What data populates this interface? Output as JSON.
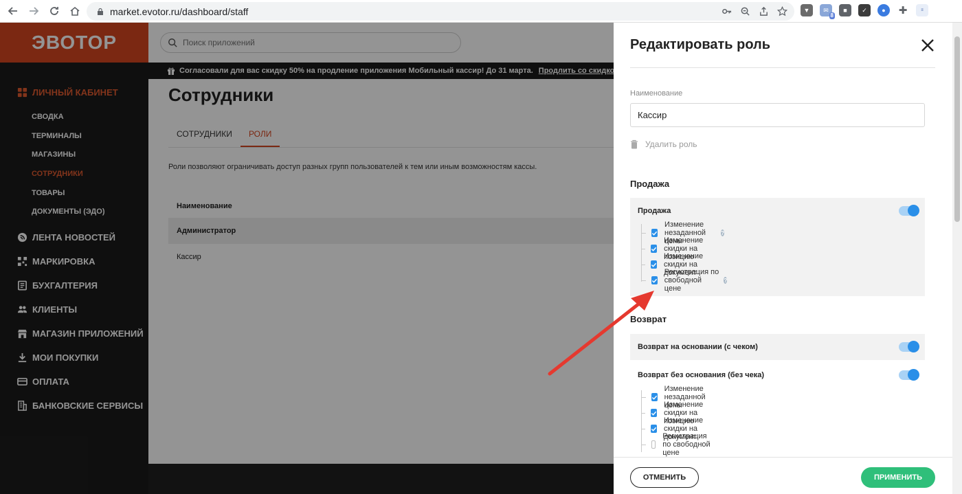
{
  "browser": {
    "url": "market.evotor.ru/dashboard/staff"
  },
  "sidebar": {
    "logo": "ЭВОТОР",
    "sections": [
      {
        "label": "ЛИЧНЫЙ КАБИНЕТ",
        "icon": "grid-icon",
        "active": true
      },
      {
        "label": "ЛЕНТА НОВОСТЕЙ",
        "icon": "news-icon"
      },
      {
        "label": "МАРКИРОВКА",
        "icon": "qr-icon"
      },
      {
        "label": "БУХГАЛТЕРИЯ",
        "icon": "ledger-icon"
      },
      {
        "label": "КЛИЕНТЫ",
        "icon": "people-icon"
      },
      {
        "label": "МАГАЗИН ПРИЛОЖЕНИЙ",
        "icon": "store-icon"
      },
      {
        "label": "МОИ ПОКУПКИ",
        "icon": "download-icon"
      },
      {
        "label": "ОПЛАТА",
        "icon": "card-icon"
      },
      {
        "label": "БАНКОВСКИЕ СЕРВИСЫ",
        "icon": "bank-icon"
      }
    ],
    "submenu": [
      {
        "label": "СВОДКА"
      },
      {
        "label": "ТЕРМИНАЛЫ"
      },
      {
        "label": "МАГАЗИНЫ"
      },
      {
        "label": "СОТРУДНИКИ",
        "active": true
      },
      {
        "label": "ТОВАРЫ"
      },
      {
        "label": "ДОКУМЕНТЫ (ЭДО)"
      }
    ]
  },
  "search": {
    "placeholder": "Поиск приложений"
  },
  "promo": {
    "text": "Согласовали для вас скидку 50% на продление приложения Мобильный кассир! До 31 марта.",
    "link": "Продлить со скидкой >>>"
  },
  "page": {
    "title": "Сотрудники",
    "tabs": [
      {
        "label": "СОТРУДНИКИ"
      },
      {
        "label": "РОЛИ",
        "active": true
      }
    ],
    "description": "Роли позволяют ограничивать доступ разных групп пользователей к тем или иным возможностям кассы.",
    "table": {
      "header": "Наименование",
      "rows": [
        "Администратор",
        "Кассир"
      ]
    }
  },
  "drawer": {
    "title": "Редактировать роль",
    "name_label": "Наименование",
    "name_value": "Кассир",
    "delete_label": "Удалить роль",
    "sale": {
      "group_title": "Продажа",
      "toggle_label": "Продажа",
      "toggle_on": true,
      "items": [
        {
          "label": "Изменение незаданной цены",
          "checked": true,
          "help": true
        },
        {
          "label": "Изменение скидки на позицию",
          "checked": true
        },
        {
          "label": "Изменение скидки на документ",
          "checked": true
        },
        {
          "label": "Регистрация по свободной цене",
          "checked": true,
          "help": true
        }
      ]
    },
    "return": {
      "group_title": "Возврат",
      "toggle1_label": "Возврат на основании (с чеком)",
      "toggle1_on": true,
      "toggle2_label": "Возврат без основания (без чека)",
      "toggle2_on": true,
      "items": [
        {
          "label": "Изменение незаданной цены",
          "checked": true
        },
        {
          "label": "Изменение скидки на позицию",
          "checked": true
        },
        {
          "label": "Изменение скидки на документ",
          "checked": true
        },
        {
          "label": "Регистрация по свободной цене",
          "checked": false
        }
      ]
    },
    "cancel_label": "ОТМЕНИТЬ",
    "apply_label": "ПРИМЕНИТЬ"
  },
  "colors": {
    "brand": "#d4451f",
    "accent_blue": "#2a8fe8",
    "apply_green": "#2fbf7a",
    "annotation_arrow": "#e5392f"
  }
}
